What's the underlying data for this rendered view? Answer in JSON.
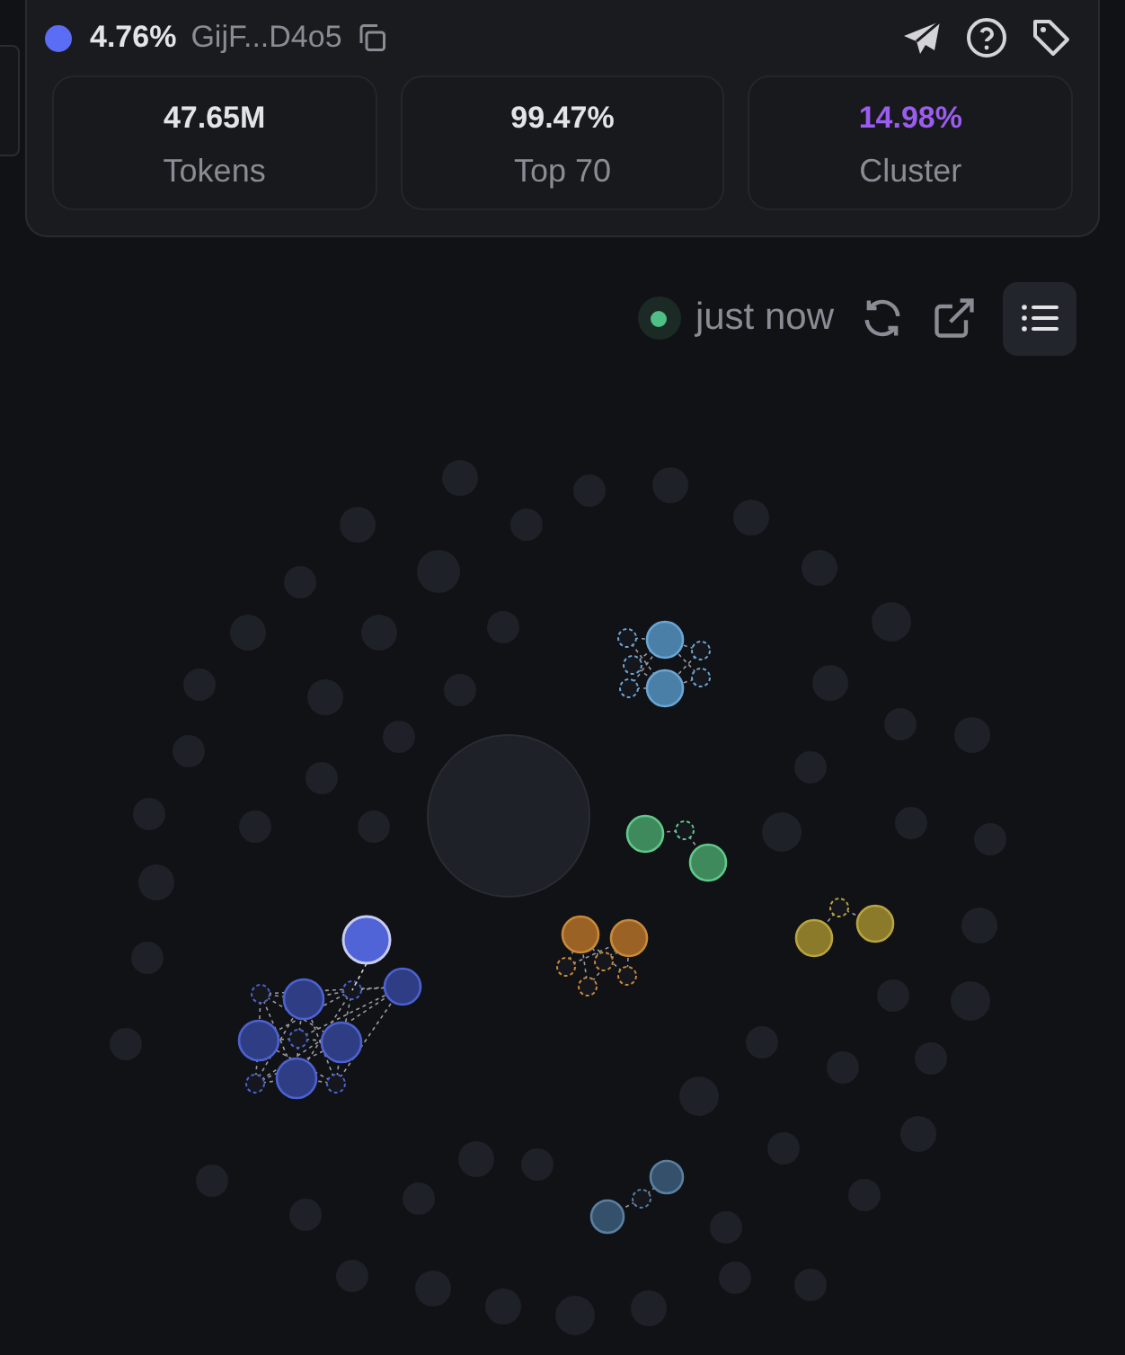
{
  "header": {
    "percent": "4.76%",
    "address": "GijF...D4o5"
  },
  "stats": [
    {
      "value": "47.65M",
      "label": "Tokens",
      "color": "#e4e4e7"
    },
    {
      "value": "99.47%",
      "label": "Top 70",
      "color": "#e4e4e7"
    },
    {
      "value": "14.98%",
      "label": "Cluster",
      "color": "#9b5cf0"
    }
  ],
  "toolbar": {
    "updated": "just now",
    "list_view": true
  }
}
